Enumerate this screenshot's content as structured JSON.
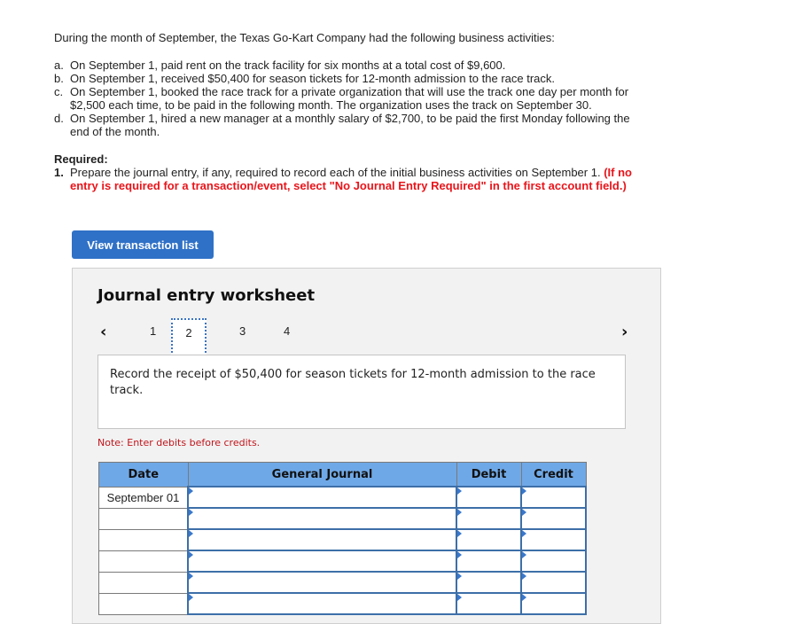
{
  "problem": {
    "intro": "During the month of September, the Texas Go-Kart Company had the following business activities:",
    "activities": [
      {
        "label": "a.",
        "text": "On September 1, paid rent on the track facility for six months at a total cost of $9,600."
      },
      {
        "label": "b.",
        "text": "On September 1, received $50,400 for season tickets for 12-month admission to the race track."
      },
      {
        "label": "c.",
        "text": "On September 1, booked the race track for a private organization that will use the track one day per month for $2,500 each time, to be paid in the following month. The organization uses the track on September 30."
      },
      {
        "label": "d.",
        "text": "On September 1, hired a new manager at a monthly salary of $2,700, to be paid the first Monday following the end of the month."
      }
    ],
    "required_title": "Required:",
    "required_num": "1.",
    "required_text": "Prepare the journal entry, if any, required to record each of the initial business activities on September 1.",
    "required_red": "(If no entry is required for a transaction/event, select \"No Journal Entry Required\" in the first account field.)"
  },
  "buttons": {
    "view_transaction_list": "View transaction list"
  },
  "worksheet": {
    "title": "Journal entry worksheet",
    "prev_icon": "‹",
    "next_icon": "›",
    "pages": [
      "1",
      "2",
      "3",
      "4"
    ],
    "active_page": "2",
    "description": "Record the receipt of $50,400 for season tickets for 12-month admission to the race track.",
    "note": "Note: Enter debits before credits.",
    "table": {
      "headers": [
        "Date",
        "General Journal",
        "Debit",
        "Credit"
      ],
      "rows": [
        {
          "date": "September 01",
          "account": "",
          "debit": "",
          "credit": ""
        },
        {
          "date": "",
          "account": "",
          "debit": "",
          "credit": ""
        },
        {
          "date": "",
          "account": "",
          "debit": "",
          "credit": ""
        },
        {
          "date": "",
          "account": "",
          "debit": "",
          "credit": ""
        },
        {
          "date": "",
          "account": "",
          "debit": "",
          "credit": ""
        },
        {
          "date": "",
          "account": "",
          "debit": "",
          "credit": ""
        }
      ]
    }
  }
}
